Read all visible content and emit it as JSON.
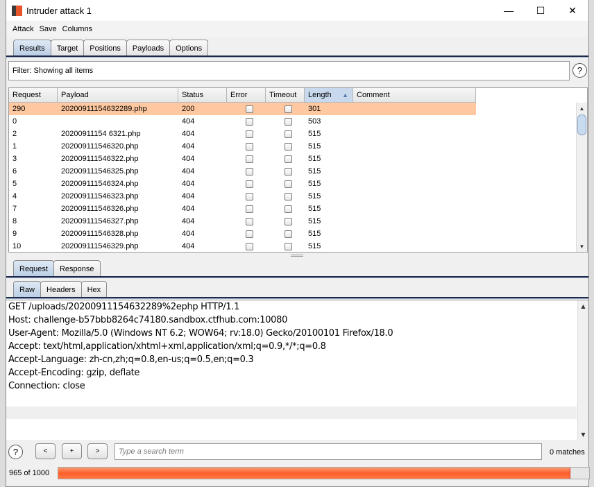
{
  "window": {
    "title": "Intruder attack 1",
    "controls": [
      "—",
      "☐",
      "✕"
    ]
  },
  "menu": [
    "Attack",
    "Save",
    "Columns"
  ],
  "main_tabs": [
    {
      "label": "Results",
      "selected": true
    },
    {
      "label": "Target"
    },
    {
      "label": "Positions"
    },
    {
      "label": "Payloads"
    },
    {
      "label": "Options"
    }
  ],
  "filter": {
    "text": "Filter:  Showing all items",
    "help": "?"
  },
  "table": {
    "columns": [
      "Request",
      "Payload",
      "Status",
      "Error",
      "Timeout",
      "Length",
      "Comment"
    ],
    "sorted_column": "Length",
    "sort_indicator": "▲",
    "rows": [
      {
        "request": "290",
        "payload": "20200911154632289.php",
        "status": "200",
        "error": false,
        "timeout": false,
        "length": "301",
        "selected": true
      },
      {
        "request": "0",
        "payload": "",
        "status": "404",
        "error": false,
        "timeout": false,
        "length": "503"
      },
      {
        "request": "2",
        "payload": "20200911154 6321.php",
        "status": "404",
        "error": false,
        "timeout": false,
        "length": "515"
      },
      {
        "request": "1",
        "payload": "202009111546320.php",
        "status": "404",
        "error": false,
        "timeout": false,
        "length": "515"
      },
      {
        "request": "3",
        "payload": "202009111546322.php",
        "status": "404",
        "error": false,
        "timeout": false,
        "length": "515"
      },
      {
        "request": "6",
        "payload": "202009111546325.php",
        "status": "404",
        "error": false,
        "timeout": false,
        "length": "515"
      },
      {
        "request": "5",
        "payload": "202009111546324.php",
        "status": "404",
        "error": false,
        "timeout": false,
        "length": "515"
      },
      {
        "request": "4",
        "payload": "202009111546323.php",
        "status": "404",
        "error": false,
        "timeout": false,
        "length": "515"
      },
      {
        "request": "7",
        "payload": "202009111546326.php",
        "status": "404",
        "error": false,
        "timeout": false,
        "length": "515"
      },
      {
        "request": "8",
        "payload": "202009111546327.php",
        "status": "404",
        "error": false,
        "timeout": false,
        "length": "515"
      },
      {
        "request": "9",
        "payload": "202009111546328.php",
        "status": "404",
        "error": false,
        "timeout": false,
        "length": "515"
      },
      {
        "request": "10",
        "payload": "202009111546329.php",
        "status": "404",
        "error": false,
        "timeout": false,
        "length": "515"
      }
    ]
  },
  "detail_tabs": [
    {
      "label": "Request",
      "selected": true
    },
    {
      "label": "Response"
    }
  ],
  "view_tabs": [
    {
      "label": "Raw",
      "selected": true
    },
    {
      "label": "Headers"
    },
    {
      "label": "Hex"
    }
  ],
  "request_lines": [
    "GET /uploads/20200911154632289%2ephp HTTP/1.1",
    "Host: challenge-b57bbb8264c74180.sandbox.ctfhub.com:10080",
    "User-Agent: Mozilla/5.0 (Windows NT 6.2; WOW64; rv:18.0) Gecko/20100101 Firefox/18.0",
    "Accept: text/html,application/xhtml+xml,application/xml;q=0.9,*/*;q=0.8",
    "Accept-Language: zh-cn,zh;q=0.8,en-us;q=0.5,en;q=0.3",
    "Accept-Encoding: gzip, deflate",
    "Connection: close"
  ],
  "search": {
    "prev": "<",
    "add": "+",
    "next": ">",
    "placeholder": "Type a search term",
    "matches": "0 matches",
    "help": "?"
  },
  "progress": {
    "label": "965 of 1000",
    "done": 965,
    "total": 1000,
    "color": "#ff6633"
  }
}
